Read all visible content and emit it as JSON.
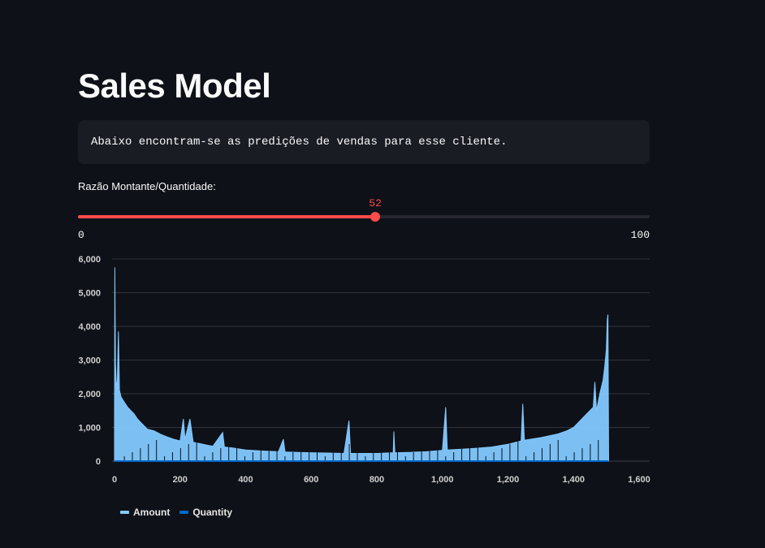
{
  "page": {
    "title": "Sales Model",
    "info_text": "Abaixo encontram-se as predições de vendas para esse cliente."
  },
  "slider": {
    "label": "Razão Montante/Quantidade:",
    "value": 52,
    "min": 0,
    "max": 100,
    "value_label": "52",
    "min_label": "0",
    "max_label": "100",
    "accent_color": "#ff4b4b"
  },
  "chart_data": {
    "type": "area",
    "xlim": [
      0,
      1600
    ],
    "ylim": [
      0,
      6000
    ],
    "x_ticks": [
      0,
      200,
      400,
      600,
      800,
      1000,
      1200,
      1400,
      1600
    ],
    "x_tick_labels": [
      "0",
      "200",
      "400",
      "600",
      "800",
      "1,000",
      "1,200",
      "1,400",
      "1,600"
    ],
    "y_ticks": [
      0,
      1000,
      2000,
      3000,
      4000,
      5000,
      6000
    ],
    "y_tick_labels": [
      "0",
      "1,000",
      "2,000",
      "3,000",
      "4,000",
      "5,000",
      "6,000"
    ],
    "grid": true,
    "legend_position": "bottom-left",
    "series": [
      {
        "name": "Amount",
        "color": "#83c9ff",
        "points": [
          [
            0,
            1150
          ],
          [
            1,
            5750
          ],
          [
            3,
            2900
          ],
          [
            5,
            2400
          ],
          [
            8,
            2100
          ],
          [
            12,
            3850
          ],
          [
            15,
            2100
          ],
          [
            20,
            1900
          ],
          [
            30,
            1750
          ],
          [
            40,
            1600
          ],
          [
            50,
            1500
          ],
          [
            60,
            1400
          ],
          [
            70,
            1250
          ],
          [
            80,
            1150
          ],
          [
            90,
            1050
          ],
          [
            100,
            950
          ],
          [
            120,
            900
          ],
          [
            140,
            800
          ],
          [
            160,
            720
          ],
          [
            180,
            650
          ],
          [
            200,
            600
          ],
          [
            210,
            1250
          ],
          [
            215,
            650
          ],
          [
            230,
            1250
          ],
          [
            240,
            560
          ],
          [
            260,
            520
          ],
          [
            280,
            480
          ],
          [
            300,
            440
          ],
          [
            330,
            850
          ],
          [
            335,
            420
          ],
          [
            360,
            390
          ],
          [
            400,
            330
          ],
          [
            450,
            300
          ],
          [
            500,
            280
          ],
          [
            515,
            650
          ],
          [
            520,
            270
          ],
          [
            560,
            260
          ],
          [
            600,
            250
          ],
          [
            650,
            240
          ],
          [
            700,
            230
          ],
          [
            715,
            1200
          ],
          [
            720,
            230
          ],
          [
            760,
            230
          ],
          [
            800,
            230
          ],
          [
            850,
            250
          ],
          [
            852,
            880
          ],
          [
            855,
            250
          ],
          [
            900,
            260
          ],
          [
            950,
            280
          ],
          [
            1000,
            320
          ],
          [
            1010,
            1600
          ],
          [
            1015,
            330
          ],
          [
            1050,
            350
          ],
          [
            1100,
            380
          ],
          [
            1150,
            420
          ],
          [
            1200,
            500
          ],
          [
            1240,
            600
          ],
          [
            1245,
            1700
          ],
          [
            1250,
            620
          ],
          [
            1300,
            700
          ],
          [
            1350,
            800
          ],
          [
            1380,
            900
          ],
          [
            1400,
            1000
          ],
          [
            1420,
            1200
          ],
          [
            1440,
            1400
          ],
          [
            1460,
            1600
          ],
          [
            1465,
            2350
          ],
          [
            1470,
            1500
          ],
          [
            1480,
            2000
          ],
          [
            1490,
            2400
          ],
          [
            1495,
            2800
          ],
          [
            1500,
            3300
          ],
          [
            1503,
            4200
          ],
          [
            1505,
            4350
          ],
          [
            1507,
            0
          ]
        ]
      },
      {
        "name": "Quantity",
        "color": "#0068c9",
        "points": [
          [
            0,
            0
          ],
          [
            1507,
            0
          ]
        ]
      }
    ]
  }
}
